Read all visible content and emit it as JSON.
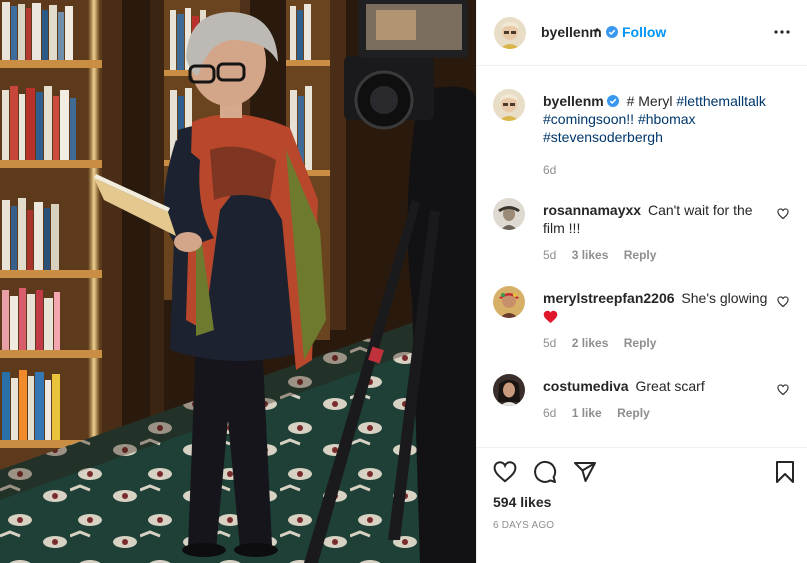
{
  "post": {
    "username": "byellenm",
    "follow_dot": "•",
    "follow_label": "Follow",
    "more_icon": "more-options-icon"
  },
  "caption": {
    "username": "byellenm",
    "text": "# Meryl",
    "hashtags": [
      "#letthemalltalk",
      "#comingsoon!!",
      "#hbomax",
      "#stevensoderbergh"
    ],
    "time": "6d"
  },
  "comments": [
    {
      "username": "rosannamayxx",
      "text": "Can't wait for the film !!!",
      "time": "5d",
      "likes": "3 likes",
      "reply": "Reply"
    },
    {
      "username": "merylstreepfan2206",
      "text": "She's glowing",
      "emoji": "red-heart",
      "time": "5d",
      "likes": "2 likes",
      "reply": "Reply"
    },
    {
      "username": "costumediva",
      "text": "Great scarf",
      "time": "6d",
      "likes": "1 like",
      "reply": "Reply"
    }
  ],
  "actions": {
    "like_icon": "heart-icon",
    "comment_icon": "comment-icon",
    "share_icon": "paper-plane-icon",
    "save_icon": "bookmark-icon",
    "likes_label": "594 likes",
    "date_label": "6 DAYS AGO"
  },
  "colors": {
    "link_blue": "#0095f6",
    "hashtag": "#00376b",
    "muted": "#8e8e8e",
    "heart_red": "#ed4956",
    "verified": "#3897f0"
  }
}
